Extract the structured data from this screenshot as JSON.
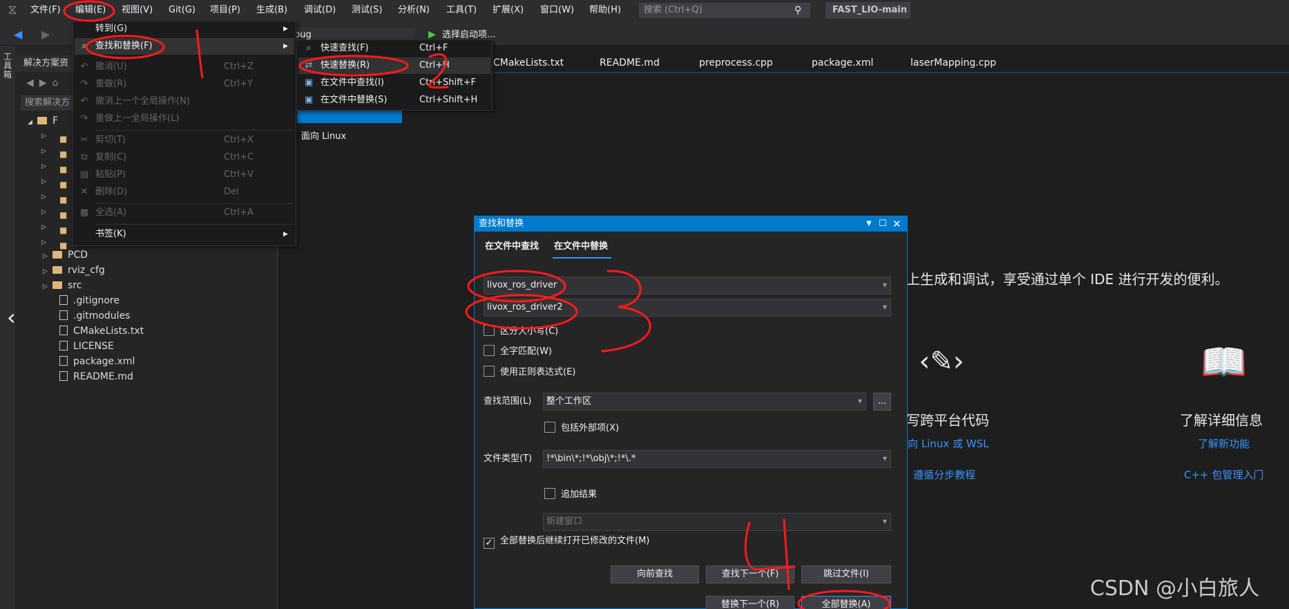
{
  "menubar": {
    "items": [
      "文件(F)",
      "编辑(E)",
      "视图(V)",
      "Git(G)",
      "项目(P)",
      "生成(B)",
      "调试(D)",
      "测试(S)",
      "分析(N)",
      "工具(T)",
      "扩展(X)",
      "窗口(W)",
      "帮助(H)"
    ],
    "search_placeholder": "搜索 (Ctrl+Q)",
    "solution_name": "FAST_LIO-main"
  },
  "toolbar": {
    "config_value": "bug",
    "startup_label": "选择启动项..."
  },
  "toolstrip": {
    "label": "工具箱"
  },
  "solution_explorer": {
    "title": "解决方案资",
    "search_placeholder": "搜索解决方",
    "root": "F",
    "items": [
      {
        "label": "PCD",
        "kind": "folder"
      },
      {
        "label": "rviz_cfg",
        "kind": "folder"
      },
      {
        "label": "src",
        "kind": "folder"
      },
      {
        "label": ".gitignore",
        "kind": "file"
      },
      {
        "label": ".gitmodules",
        "kind": "file"
      },
      {
        "label": "CMakeLists.txt",
        "kind": "file"
      },
      {
        "label": "LICENSE",
        "kind": "file"
      },
      {
        "label": "package.xml",
        "kind": "file"
      },
      {
        "label": "README.md",
        "kind": "file"
      }
    ]
  },
  "editor": {
    "tabs": [
      "CMakeLists.txt",
      "README.md",
      "preprocess.cpp",
      "package.xml",
      "laserMapping.cpp"
    ],
    "linux_label": "面向 Linux",
    "start_desc": "上生成和调试，享受通过单个 IDE 进行开发的便利。",
    "col1_title": "写跨平台代码",
    "col1_link1": "向 Linux 或 WSL",
    "col1_link2": "遵循分步教程",
    "col2_title": "了解详细信息",
    "col2_link1": "了解新功能",
    "col2_link2": "C++ 包管理入门"
  },
  "edit_menu": {
    "items": [
      {
        "label": "转到(G)",
        "shortcut": "",
        "submenu": true,
        "disabled": false
      },
      {
        "label": "查找和替换(F)",
        "shortcut": "",
        "submenu": true,
        "disabled": false
      },
      {
        "label": "撤消(U)",
        "shortcut": "Ctrl+Z",
        "submenu": false,
        "disabled": true
      },
      {
        "label": "重做(R)",
        "shortcut": "Ctrl+Y",
        "submenu": false,
        "disabled": true
      },
      {
        "label": "撤消上一个全局操作(N)",
        "shortcut": "",
        "submenu": false,
        "disabled": true
      },
      {
        "label": "重做上一全局操作(L)",
        "shortcut": "",
        "submenu": false,
        "disabled": true
      },
      {
        "label": "剪切(T)",
        "shortcut": "Ctrl+X",
        "submenu": false,
        "disabled": true
      },
      {
        "label": "复制(C)",
        "shortcut": "Ctrl+C",
        "submenu": false,
        "disabled": true
      },
      {
        "label": "粘贴(P)",
        "shortcut": "Ctrl+V",
        "submenu": false,
        "disabled": true
      },
      {
        "label": "删除(D)",
        "shortcut": "Del",
        "submenu": false,
        "disabled": true
      },
      {
        "label": "全选(A)",
        "shortcut": "Ctrl+A",
        "submenu": false,
        "disabled": true
      },
      {
        "label": "书签(K)",
        "shortcut": "",
        "submenu": true,
        "disabled": false
      }
    ]
  },
  "find_submenu": {
    "items": [
      {
        "label": "快速查找(F)",
        "shortcut": "Ctrl+F"
      },
      {
        "label": "快速替换(R)",
        "shortcut": "Ctrl+H"
      },
      {
        "label": "在文件中查找(I)",
        "shortcut": "Ctrl+Shift+F"
      },
      {
        "label": "在文件中替换(S)",
        "shortcut": "Ctrl+Shift+H"
      }
    ]
  },
  "dialog": {
    "title": "查找和替换",
    "tabs": [
      "在文件中查找",
      "在文件中替换"
    ],
    "find_value": "livox_ros_driver",
    "replace_value": "livox_ros_driver2",
    "match_case": "区分大小写(C)",
    "whole_word": "全字匹配(W)",
    "regex": "使用正则表达式(E)",
    "scope_label": "查找范围(L)",
    "scope_value": "整个工作区",
    "scope_browse": "...",
    "include_external": "包括外部项(X)",
    "filetype_label": "文件类型(T)",
    "filetype_value": "!*\\bin\\*;!*\\obj\\*;!*\\.*",
    "append_results": "追加结果",
    "new_window": "新建窗口",
    "keep_open": "全部替换后继续打开已修改的文件(M)",
    "keep_open_checked": true,
    "btn_find_prev": "向前查找",
    "btn_find_next": "查找下一个(F)",
    "btn_skip": "跳过文件(I)",
    "btn_replace_next": "替换下一个(R)",
    "btn_replace_all": "全部替换(A)"
  },
  "annotations": {
    "labels": [
      "1",
      "2",
      "3",
      "4"
    ],
    "color": "#ff1a1a"
  },
  "watermark": "CSDN @小白旅人",
  "colors": {
    "accent": "#007acc",
    "link": "#3794ff",
    "annotation": "#ff1a1a"
  }
}
